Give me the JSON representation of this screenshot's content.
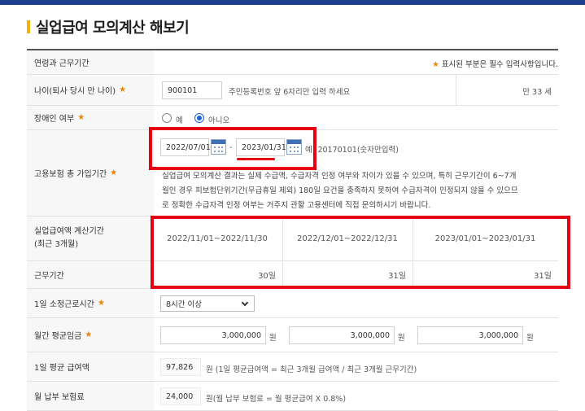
{
  "page": {
    "title": "실업급여 모의계산 해보기"
  },
  "colors": {
    "accent_bar": "#1d3e8f",
    "title_mark": "#f0b400",
    "required_star": "#e8860c",
    "highlight": "#e50012"
  },
  "header_row": {
    "label": "연령과 근무기간",
    "required_note_star": "★",
    "required_note": "표시된 부분은 필수 입력사항입니다."
  },
  "age_row": {
    "label": "나이(퇴사 당시 만 나이)",
    "star": "★",
    "input_value": "900101",
    "hint": "주민등록번호 앞 6자리만 입력 하세요",
    "result": "만 33 세"
  },
  "disability_row": {
    "label": "장애인 여부",
    "star": "★",
    "option_yes": "예",
    "option_no": "아니오",
    "selected": "아니오"
  },
  "insurance_row": {
    "label": "고용보험 총 가입기간",
    "star": "★",
    "start_date": "2022/07/01",
    "separator": "-",
    "end_date": "2023/01/31",
    "example": "예) 20170101(숫자만입력)",
    "notice_lines": [
      "실업급여 모의계산 결과는 실제 수급액, 수급자격 인정 여부와 차이가 있을 수 있으며, 특히 근무기간이 6~7개",
      "월인 경우 피보험단위기간(무급휴일 제외) 180일 요건을 충족하지 못하여 수급자격이 인정되지 않을 수 있으므",
      "로 정확한 수급자격 인정 여부는 거주지 관할 고용센터에 직접 문의하시기 바랍니다."
    ]
  },
  "calc_period_row": {
    "label_line1": "실업급여액 계산기간",
    "label_line2": "(최근 3개월)",
    "periods": [
      "2022/11/01~2022/11/30",
      "2022/12/01~2022/12/31",
      "2023/01/01~2023/01/31"
    ]
  },
  "work_days_row": {
    "label": "근무기간",
    "days": [
      "30일",
      "31일",
      "31일"
    ]
  },
  "work_hours_row": {
    "label": "1일 소정근로시간",
    "star": "★",
    "selected": "8시간 이상"
  },
  "wage_row": {
    "label": "월간 평균임금",
    "star": "★",
    "values": [
      "3,000,000",
      "3,000,000",
      "3,000,000"
    ],
    "unit": "원"
  },
  "daily_wage_row": {
    "label": "1일 평균 급여액",
    "value": "97,826",
    "note": "원 (1일 평균급여액 = 최근 3개월 급여액 / 최근 3개월 근무기간)"
  },
  "premium_row": {
    "label": "월 납부 보험료",
    "value": "24,000",
    "note": "원(월 납부 보험료 = 월 평균급여 X 0.8%)"
  }
}
